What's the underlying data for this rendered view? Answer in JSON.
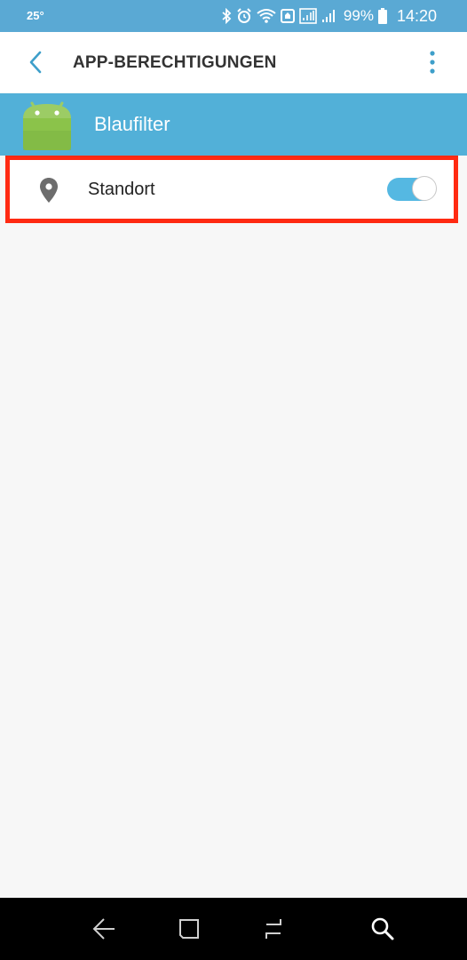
{
  "status_bar": {
    "temperature": "25°",
    "battery_percent": "99%",
    "time": "14:20"
  },
  "app_bar": {
    "title": "APP-BERECHTIGUNGEN"
  },
  "app_header": {
    "app_name": "Blaufilter"
  },
  "permissions": [
    {
      "label": "Standort",
      "enabled": true
    }
  ],
  "colors": {
    "status_bar": "#5aa9d4",
    "header": "#52b0d8",
    "accent": "#3e9fca",
    "highlight": "#ff2a12",
    "android_green": "#8bc34a"
  },
  "icons": {
    "back": "chevron-left-icon",
    "more": "more-vertical-icon",
    "location": "location-pin-icon",
    "nav_back": "nav-back-icon",
    "nav_home": "nav-home-icon",
    "nav_recents": "nav-recents-icon",
    "nav_search": "nav-search-icon"
  }
}
